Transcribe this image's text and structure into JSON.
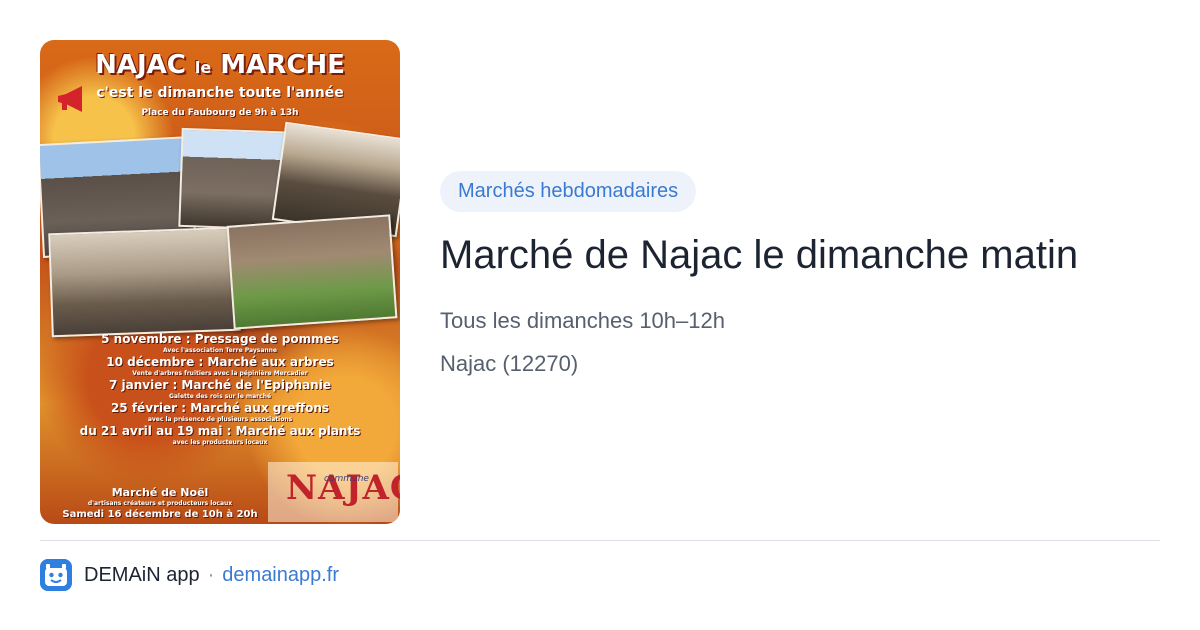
{
  "event_image": {
    "title_main": "NAJAC",
    "title_small": "le",
    "title_end": "MARCHE",
    "subtitle": "c'est le dimanche toute l'année",
    "place": "Place du Faubourg de 9h à 13h",
    "events": [
      {
        "line": "5 novembre : Pressage de pommes",
        "sub": "Avec l'association Terre Paysanne"
      },
      {
        "line": "10 décembre : Marché aux arbres",
        "sub": "Vente d'arbres fruitiers avec la pépinière Mercadier"
      },
      {
        "line": "7 janvier : Marché de l'Epiphanie",
        "sub": "Galette des rois sur le marché"
      },
      {
        "line": "25 février : Marché aux greffons",
        "sub": "avec la présence de plusieurs associations"
      },
      {
        "line": "du 21 avril au 19 mai : Marché aux plants",
        "sub": "avec les producteurs locaux"
      }
    ],
    "noel_title": "Marché de Noël",
    "noel_sub": "d'artisans créateurs et producteurs locaux",
    "noel_date": "Samedi 16 décembre de 10h à 20h",
    "commune_label": "commune",
    "commune_name": "NAJAC"
  },
  "category_badge": "Marchés hebdomadaires",
  "title": "Marché de Najac le dimanche matin",
  "schedule": "Tous les dimanches 10h–12h",
  "location": "Najac (12270)",
  "footer": {
    "app_icon": "demain-app-logo-icon",
    "app_name": "DEMAiN app",
    "separator": "·",
    "domain": "demainapp.fr"
  },
  "colors": {
    "accent": "#3a7ad1",
    "badge_bg": "#eef3fb",
    "title": "#1c2331",
    "meta": "#56606e"
  }
}
